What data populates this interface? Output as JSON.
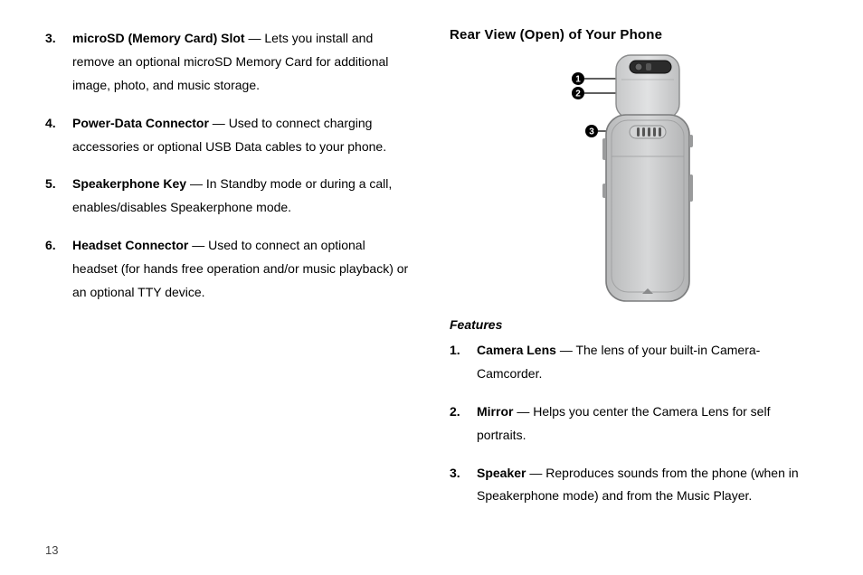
{
  "pageNumber": "13",
  "left": {
    "startIndex": 3,
    "items": [
      {
        "term": "microSD (Memory Card) Slot",
        "desc": " — Lets you install and remove an optional microSD Memory Card for additional image, photo, and music storage."
      },
      {
        "term": "Power-Data Connector",
        "desc": " — Used to connect charging accessories or optional USB Data cables to your phone."
      },
      {
        "term": "Speakerphone Key",
        "desc": " — In Standby mode or during a call, enables/disables Speakerphone mode."
      },
      {
        "term": " Headset Connector",
        "desc": " — Used to connect an optional headset (for hands free operation and/or music playback) or an optional TTY device."
      }
    ]
  },
  "right": {
    "heading": "Rear View (Open) of Your Phone",
    "subheading": "Features",
    "startIndex": 1,
    "items": [
      {
        "term": "Camera Lens",
        "desc": " — The lens of your built-in Camera-Camcorder."
      },
      {
        "term": "Mirror",
        "desc": " — Helps you center the Camera Lens for self portraits."
      },
      {
        "term": "Speaker",
        "desc": " — Reproduces sounds from the phone (when in Speakerphone mode) and from the Music Player."
      }
    ],
    "callouts": [
      "1",
      "2",
      "3"
    ]
  }
}
